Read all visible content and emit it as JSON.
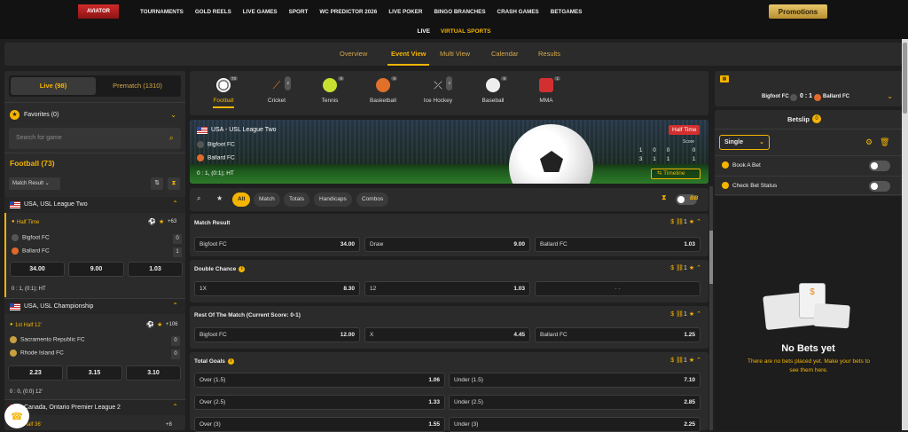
{
  "topnav": {
    "aviator": "AVIATOR",
    "links": [
      "TOURNAMENTS",
      "GOLD REELS",
      "LIVE GAMES",
      "SPORT",
      "WC PREDICTOR 2026",
      "LIVE POKER",
      "BINGO BRANCHES",
      "CRASH GAMES",
      "BETGAMES"
    ],
    "promotions": "Promotions"
  },
  "subnav": {
    "live": "LIVE",
    "virtual": "VIRTUAL SPORTS"
  },
  "tabs": [
    "Overview",
    "Event View",
    "Multi View",
    "Calendar",
    "Results"
  ],
  "left": {
    "live_tab": "Live (98)",
    "prematch_tab": "Prematch (1310)",
    "favorites": "Favorites (0)",
    "search_placeholder": "Search for game",
    "football_header": "Football (73)",
    "market_select": "Match Result",
    "leagues": [
      {
        "name": "USA, USL League Two",
        "status": "Half Time",
        "more": "+63",
        "team1": "Bigfoot FC",
        "team2": "Ballard FC",
        "score1": "0",
        "score2": "1",
        "odds": [
          "34.00",
          "9.00",
          "1.03"
        ],
        "summary": "0 : 1, (0:1); HT"
      },
      {
        "name": "USA, USL Championship",
        "status": "1st Half 12'",
        "more": "+106",
        "team1": "Sacramento Republic FC",
        "team2": "Rhode Island FC",
        "score1": "0",
        "score2": "0",
        "odds": [
          "2.23",
          "3.15",
          "3.10"
        ],
        "summary": "0 : 0, (0:0) 12'"
      },
      {
        "name": "Canada, Ontario Premier League 2",
        "status": "1st Half 36'",
        "more": "+8"
      }
    ]
  },
  "sports": [
    {
      "name": "Football",
      "count": "73"
    },
    {
      "name": "Cricket",
      "count": "2"
    },
    {
      "name": "Tennis",
      "count": "9"
    },
    {
      "name": "Basketball",
      "count": "6"
    },
    {
      "name": "Ice Hockey",
      "count": "2"
    },
    {
      "name": "Baseball",
      "count": "6"
    },
    {
      "name": "MMA",
      "count": "1"
    }
  ],
  "event": {
    "league": "USA - USL League Two",
    "status": "Half Time",
    "team1": "Bigfoot FC",
    "team2": "Ballard FC",
    "summary": "0 : 1, (0:1); HT",
    "stats_head": "Score",
    "stats1": [
      "1",
      "0",
      "0",
      "0"
    ],
    "stats2": [
      "3",
      "1",
      "1",
      "1"
    ],
    "timeline": "Timeline"
  },
  "filters": {
    "all": "All",
    "chips": [
      "Match",
      "Totals",
      "Handicaps",
      "Combos"
    ],
    "bb": "BB"
  },
  "markets": [
    {
      "title": "Match Result",
      "count": "1",
      "cells": [
        [
          "Bigfoot FC",
          "34.00"
        ],
        [
          "Draw",
          "9.00"
        ],
        [
          "Ballard FC",
          "1.03"
        ]
      ]
    },
    {
      "title": "Double Chance",
      "count": "1",
      "cells": [
        [
          "1X",
          "8.30"
        ],
        [
          "12",
          "1.03"
        ],
        [
          "- -",
          ""
        ]
      ]
    },
    {
      "title": "Rest Of The Match (Current Score: 0-1)",
      "count": "1",
      "cells": [
        [
          "Bigfoot FC",
          "12.00"
        ],
        [
          "X",
          "4.45"
        ],
        [
          "Ballard FC",
          "1.25"
        ]
      ]
    },
    {
      "title": "Total Goals",
      "count": "1",
      "rows": [
        [
          "Over (1.5)",
          "1.06",
          "Under (1.5)",
          "7.10"
        ],
        [
          "Over (2.5)",
          "1.33",
          "Under (2.5)",
          "2.85"
        ],
        [
          "Over (3)",
          "1.55",
          "Under (3)",
          "2.25"
        ]
      ]
    }
  ],
  "right": {
    "team1": "Bigfoot FC",
    "score": "0 : 1",
    "team2": "Ballard FC",
    "betslip": "Betslip",
    "betslip_count": "0",
    "bet_type": "Single",
    "book_a_bet": "Book A Bet",
    "check_status": "Check Bet Status",
    "no_bets_title": "No Bets yet",
    "no_bets_text": "There are no bets placed yet. Make your bets to see them here."
  },
  "colors": {
    "accent": "#f4b400",
    "panel": "#2b2b2b",
    "bg": "#1f1f1f"
  }
}
